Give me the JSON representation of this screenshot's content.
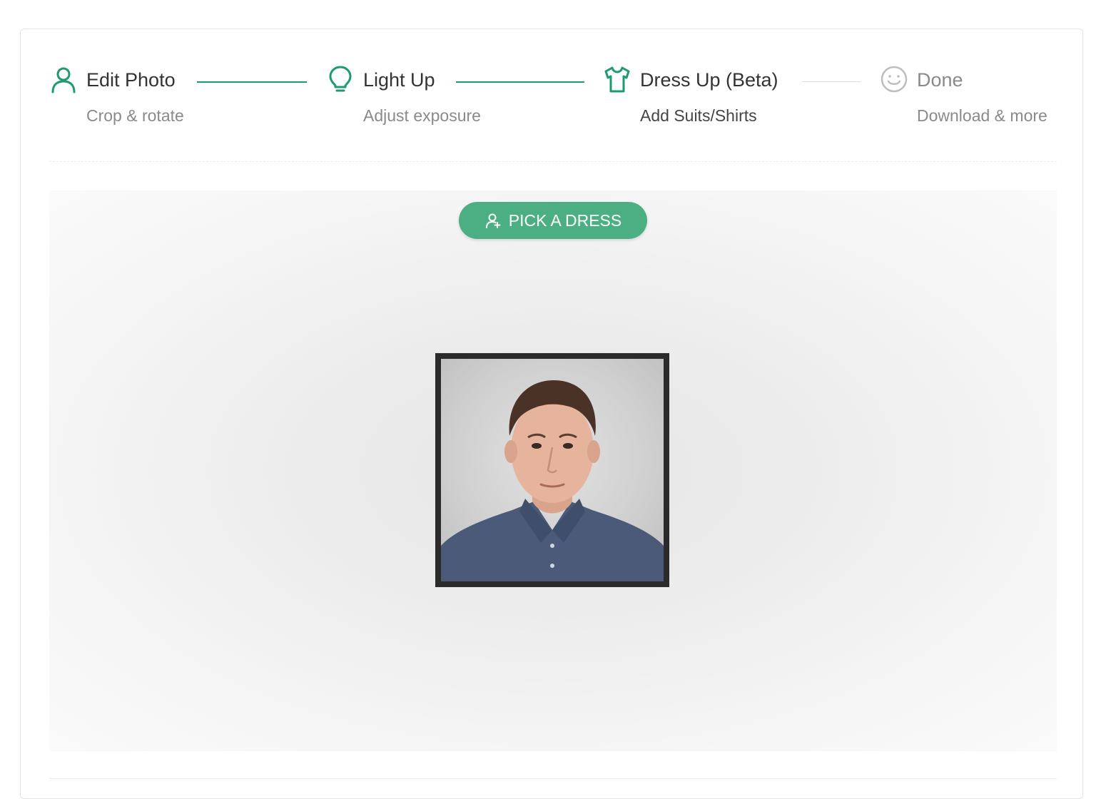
{
  "steps": [
    {
      "title": "Edit Photo",
      "subtitle": "Crop & rotate",
      "icon": "user-icon",
      "state": "done"
    },
    {
      "title": "Light Up",
      "subtitle": "Adjust exposure",
      "icon": "lightbulb-icon",
      "state": "done"
    },
    {
      "title": "Dress Up (Beta)",
      "subtitle": "Add Suits/Shirts",
      "icon": "tshirt-icon",
      "state": "active"
    },
    {
      "title": "Done",
      "subtitle": "Download & more",
      "icon": "smiley-icon",
      "state": "pending"
    }
  ],
  "action": {
    "pick_label": "PICK A DRESS",
    "icon": "add-user-icon"
  },
  "colors": {
    "accent": "#1e9a6f",
    "button": "#4caf84",
    "pending": "#bdbdbd"
  }
}
